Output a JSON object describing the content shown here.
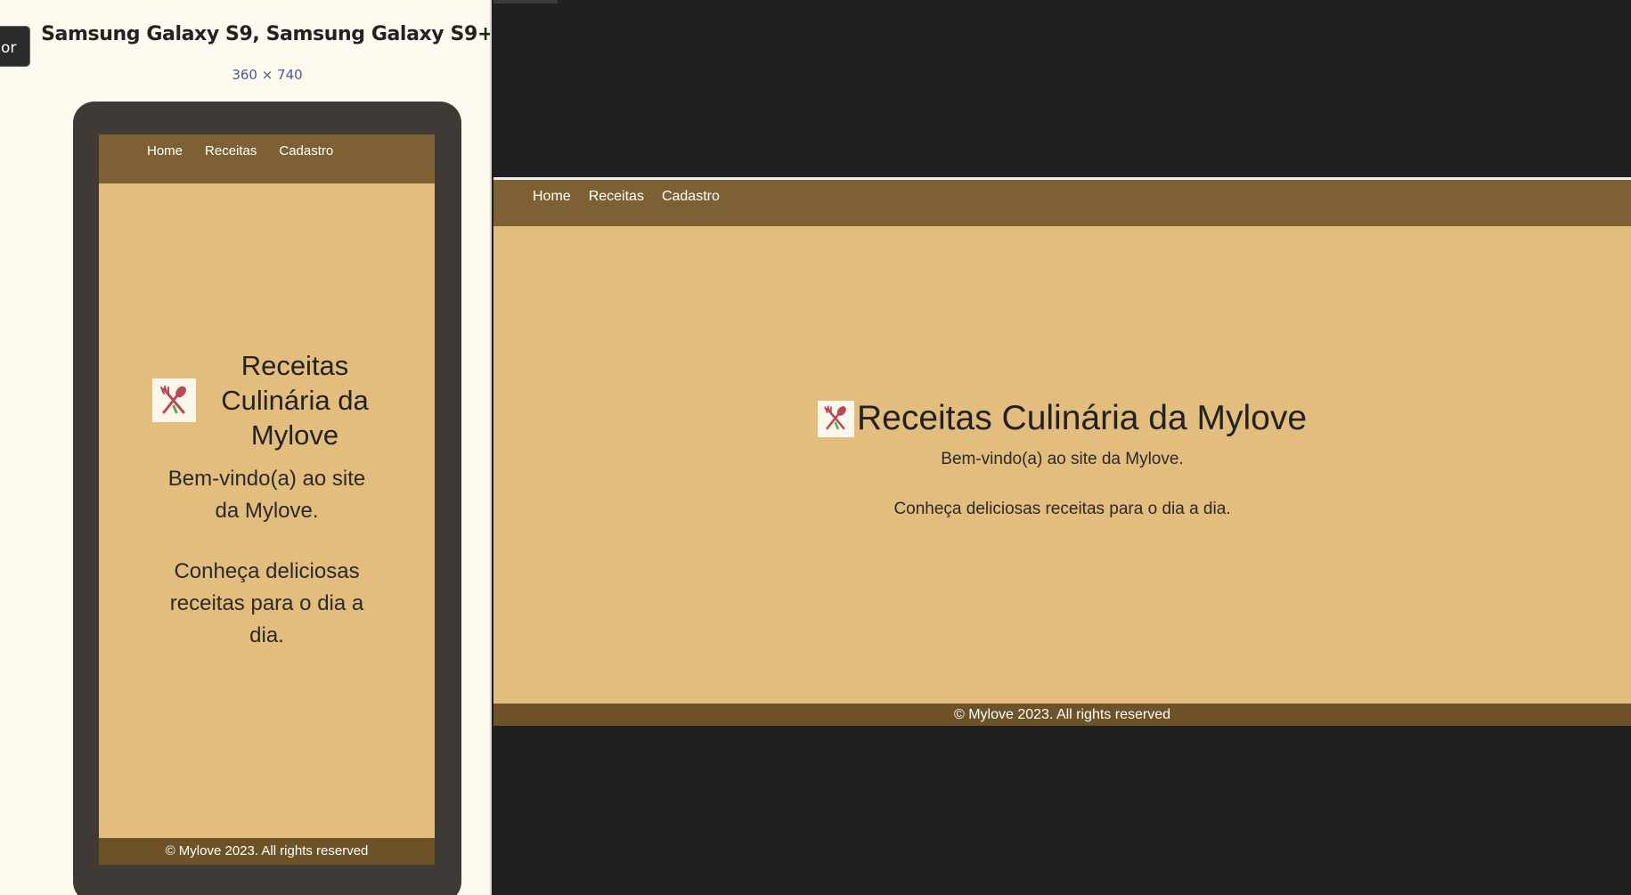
{
  "side_tab": {
    "label": "or"
  },
  "device": {
    "name": "Samsung Galaxy S9, Samsung Galaxy S9+",
    "size": "360 × 740"
  },
  "site": {
    "nav": [
      "Home",
      "Receitas",
      "Cadastro"
    ],
    "title": "Receitas Culinária da Mylove",
    "welcome": "Bem-vindo(a) ao site da Mylove.",
    "tagline": "Conheça deliciosas receitas para o dia a dia.",
    "footer": "© Mylove 2023. All rights reserved",
    "logo_icon": "fork-and-spoon-icon"
  },
  "colors": {
    "nav_bg": "#7d6134",
    "page_bg": "#e2bd7d",
    "footer_bg": "#6d5327",
    "device_frame": "#3f3a35",
    "panel_bg": "#fdf9ee",
    "viewport_bg": "#202020"
  }
}
